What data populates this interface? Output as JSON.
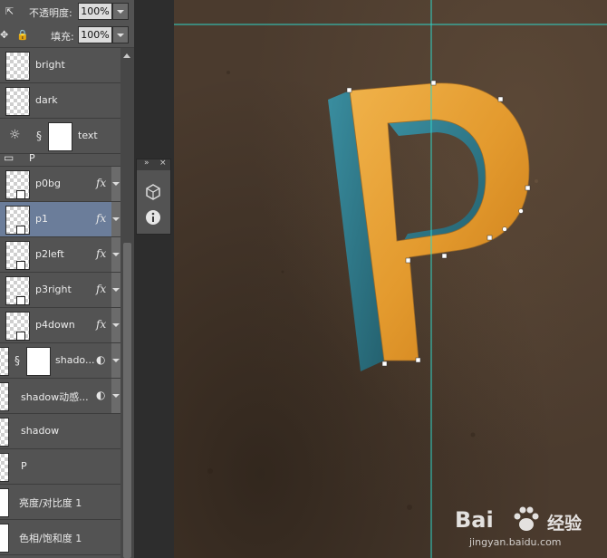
{
  "layers_panel": {
    "opacity": {
      "label": "不透明度:",
      "value": "100%"
    },
    "fill": {
      "label": "填充:",
      "value": "100%"
    },
    "items": [
      {
        "name": "bright",
        "kind": "pixel",
        "selected": false
      },
      {
        "name": "dark",
        "kind": "pixel",
        "selected": false
      },
      {
        "name": "text",
        "kind": "adjustment-mask",
        "selected": false
      },
      {
        "name": "P",
        "kind": "group",
        "selected": false
      },
      {
        "name": "p0bg",
        "kind": "smart",
        "fx": "fx",
        "selected": false
      },
      {
        "name": "p1",
        "kind": "smart",
        "fx": "fx",
        "selected": true
      },
      {
        "name": "p2left",
        "kind": "smart",
        "fx": "fx",
        "selected": false
      },
      {
        "name": "p3right",
        "kind": "smart",
        "fx": "fx",
        "selected": false
      },
      {
        "name": "p4down",
        "kind": "smart",
        "fx": "fx",
        "selected": false
      },
      {
        "name": "shado...",
        "kind": "smart-mask",
        "selected": false
      },
      {
        "name": "shadow动感...",
        "kind": "smart-filter",
        "selected": false
      },
      {
        "name": "shadow",
        "kind": "pixel",
        "selected": false
      },
      {
        "name": "P",
        "kind": "smart",
        "selected": false
      },
      {
        "name": "亮度/对比度 1",
        "kind": "adjustment",
        "selected": false
      },
      {
        "name": "色相/饱和度 1",
        "kind": "adjustment",
        "selected": false
      }
    ]
  },
  "canvas": {
    "letter": "P",
    "colors": {
      "orange": "#e39a2e",
      "teal": "#2f7a8c",
      "guide": "#2fd4c8",
      "background": "#4b3b2e"
    }
  },
  "watermark": {
    "brand": "Bai",
    "brand_suffix": "经验",
    "url": "jingyan.baidu.com"
  }
}
